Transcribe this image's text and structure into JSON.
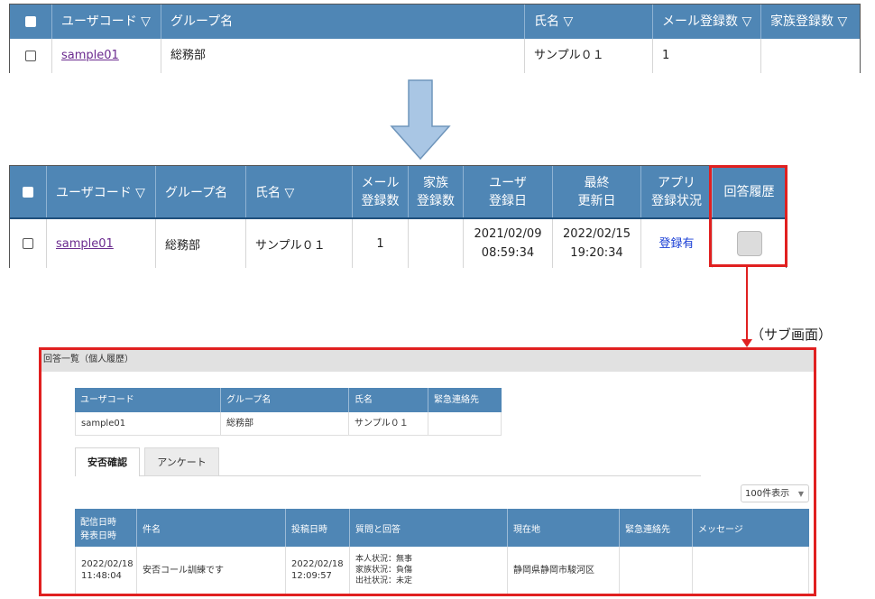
{
  "table1": {
    "headers": {
      "user_code": "ユーザコード ▽",
      "group": "グループ名",
      "name": "氏名 ▽",
      "mail_count": "メール登録数 ▽",
      "family_count": "家族登録数 ▽"
    },
    "row": {
      "user_code": "sample01",
      "group": "総務部",
      "name": "サンプル０１",
      "mail_count": "1",
      "family_count": ""
    }
  },
  "table2": {
    "headers": {
      "user_code": "ユーザコード ▽",
      "group": "グループ名",
      "name": "氏名 ▽",
      "mail_count_1": "メール",
      "mail_count_2": "登録数",
      "family_count_1": "家族",
      "family_count_2": "登録数",
      "user_reg_1": "ユーザ",
      "user_reg_2": "登録日",
      "last_update_1": "最終",
      "last_update_2": "更新日",
      "app_status_1": "アプリ",
      "app_status_2": "登録状況",
      "answer_history": "回答履歴"
    },
    "row": {
      "user_code": "sample01",
      "group": "総務部",
      "name": "サンプル０１",
      "mail_count": "1",
      "family_count": "",
      "user_reg_date": "2021/02/09",
      "user_reg_time": "08:59:34",
      "last_update_date": "2022/02/15",
      "last_update_time": "19:20:34",
      "app_status": "登録有"
    }
  },
  "connector_label": "（サブ画面）",
  "sub_screen": {
    "title": "回答一覧（個人履歴）",
    "info_headers": [
      "ユーザコード",
      "グループ名",
      "氏名",
      "緊急連絡先"
    ],
    "info_values": [
      "sample01",
      "総務部",
      "サンプル０１",
      ""
    ],
    "tabs": [
      "安否確認",
      "アンケート"
    ],
    "per_page": "100件表示",
    "result_headers": {
      "delivery_1": "配信日時",
      "delivery_2": "発表日時",
      "subject": "件名",
      "posted": "投稿日時",
      "qa": "質問と回答",
      "location": "現在地",
      "emergency": "緊急連絡先",
      "message": "メッセージ"
    },
    "result_row": {
      "delivery_date": "2022/02/18",
      "delivery_time": "11:48:04",
      "subject": "安否コール訓練です",
      "posted_date": "2022/02/18",
      "posted_time": "12:09:57",
      "qa_1": "本人状況：無事",
      "qa_2": "家族状況：負傷",
      "qa_3": "出社状況：未定",
      "location": "静岡県静岡市駿河区",
      "emergency": "",
      "message": ""
    }
  },
  "colors": {
    "header_blue": "#4f86b5",
    "highlight_red": "#e02020",
    "arrow_fill": "#a9c6e4"
  }
}
